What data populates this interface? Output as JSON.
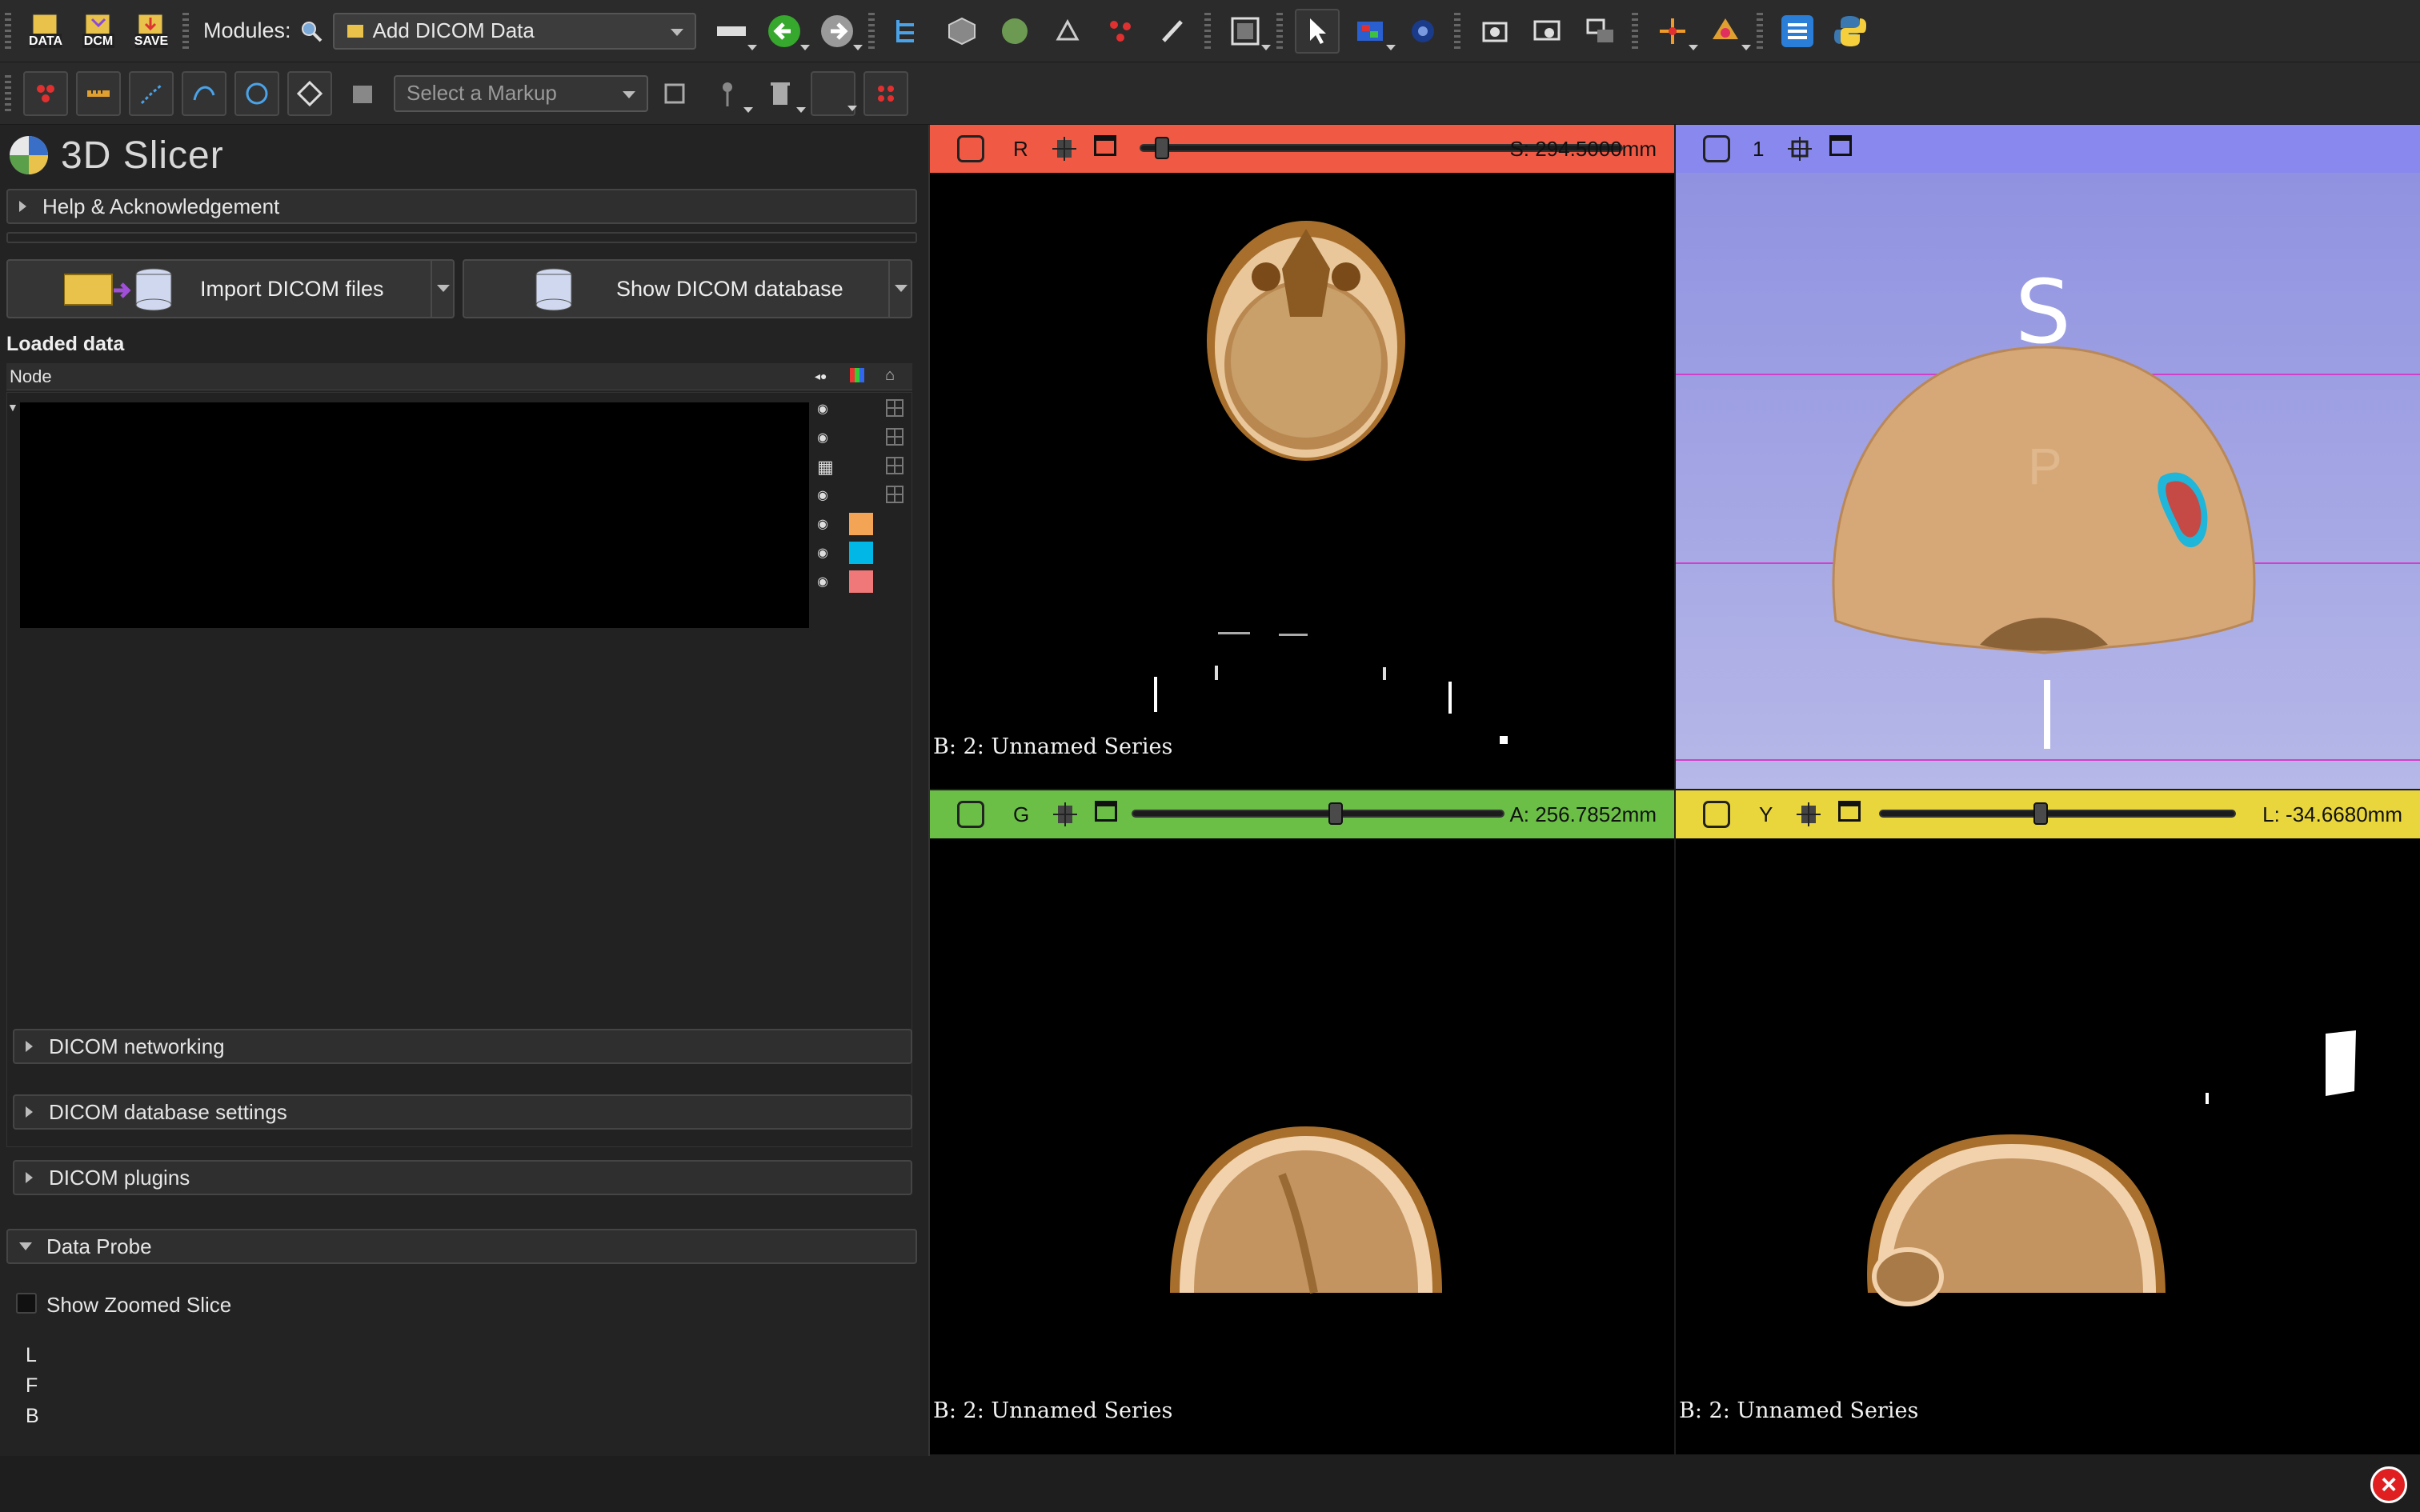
{
  "toolbar_main": {
    "data_label": "DATA",
    "dcm_label": "DCM",
    "save_label": "SAVE",
    "modules_label": "Modules:",
    "module_selected": "Add DICOM Data"
  },
  "toolbar_markups": {
    "markup_select": "Select a Markup"
  },
  "app": {
    "title": "3D Slicer"
  },
  "panel": {
    "help_section": "Help & Acknowledgement",
    "import_button": "Import DICOM files",
    "show_db_button": "Show DICOM database",
    "loaded_data_label": "Loaded data",
    "tree_column_node": "Node",
    "collapsed_sections": [
      "DICOM networking",
      "DICOM database settings",
      "DICOM plugins"
    ],
    "data_probe_section": "Data Probe",
    "show_zoomed_slice": "Show Zoomed Slice",
    "probe_rows": [
      "L",
      "F",
      "B"
    ]
  },
  "swatch_colors": [
    "#f3a455",
    "#00b7e6",
    "#f07878"
  ],
  "views": {
    "red": {
      "letter": "R",
      "value": "S: 294.5000mm",
      "caption": "B: 2: Unnamed Series",
      "color": "#f05a45",
      "slider_pos": 0.03
    },
    "threed": {
      "letter": "1",
      "orientation_top": "S",
      "orientation_back": "P",
      "color": "#8888ee"
    },
    "green": {
      "letter": "G",
      "value": "A: 256.7852mm",
      "caption": "B: 2: Unnamed Series",
      "color": "#6bbf46",
      "slider_pos": 0.55
    },
    "yellow": {
      "letter": "Y",
      "value": "L: -34.6680mm",
      "caption": "B: 2: Unnamed Series",
      "color": "#e9d63c",
      "slider_pos": 0.45
    }
  }
}
